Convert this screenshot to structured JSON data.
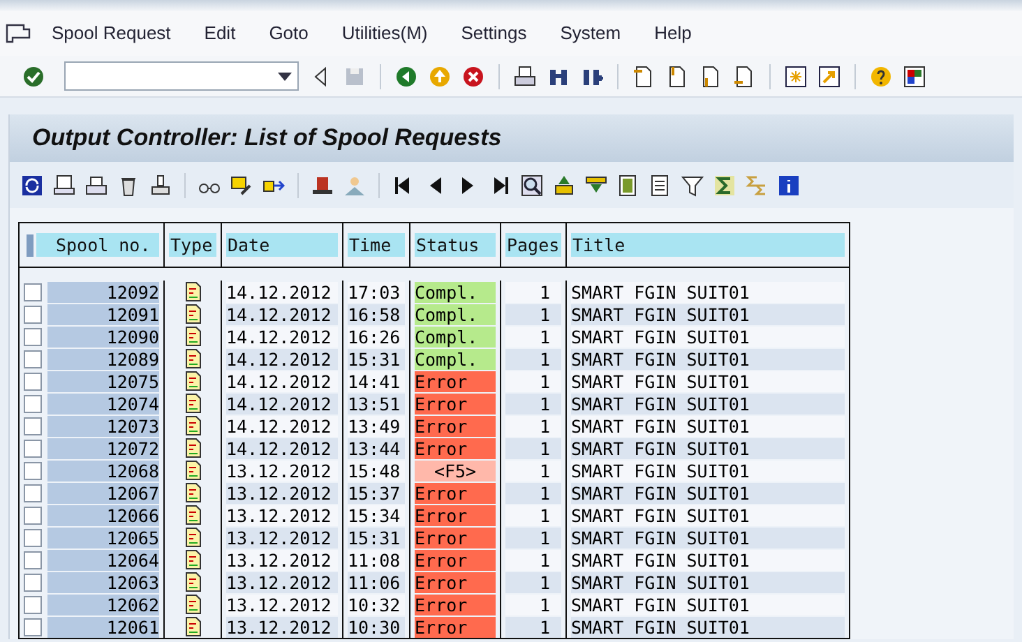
{
  "menu": [
    "Spool Request",
    "Edit",
    "Goto",
    "Utilities(M)",
    "Settings",
    "System",
    "Help"
  ],
  "title": "Output Controller: List of Spool Requests",
  "table": {
    "columns": [
      "Spool no.",
      "Type",
      "Date",
      "Time",
      "Status",
      "Pages",
      "Title"
    ],
    "rows": [
      {
        "spool": "12092",
        "checked": false,
        "date": "14.12.2012",
        "time": "17:03",
        "status": "Compl.",
        "kind": "complete",
        "pages": "1",
        "title": "SMART FGIN SUIT01"
      },
      {
        "spool": "12091",
        "checked": false,
        "date": "14.12.2012",
        "time": "16:58",
        "status": "Compl.",
        "kind": "complete",
        "pages": "1",
        "title": "SMART FGIN SUIT01"
      },
      {
        "spool": "12090",
        "checked": false,
        "date": "14.12.2012",
        "time": "16:26",
        "status": "Compl.",
        "kind": "complete",
        "pages": "1",
        "title": "SMART FGIN SUIT01"
      },
      {
        "spool": "12089",
        "checked": false,
        "date": "14.12.2012",
        "time": "15:31",
        "status": "Compl.",
        "kind": "complete",
        "pages": "1",
        "title": "SMART FGIN SUIT01"
      },
      {
        "spool": "12075",
        "checked": false,
        "date": "14.12.2012",
        "time": "14:41",
        "status": "Error",
        "kind": "error",
        "pages": "1",
        "title": "SMART FGIN SUIT01"
      },
      {
        "spool": "12074",
        "checked": false,
        "date": "14.12.2012",
        "time": "13:51",
        "status": "Error",
        "kind": "error",
        "pages": "1",
        "title": "SMART FGIN SUIT01"
      },
      {
        "spool": "12073",
        "checked": false,
        "date": "14.12.2012",
        "time": "13:49",
        "status": "Error",
        "kind": "error",
        "pages": "1",
        "title": "SMART FGIN SUIT01"
      },
      {
        "spool": "12072",
        "checked": false,
        "date": "14.12.2012",
        "time": "13:44",
        "status": "Error",
        "kind": "error",
        "pages": "1",
        "title": "SMART FGIN SUIT01"
      },
      {
        "spool": "12068",
        "checked": false,
        "date": "13.12.2012",
        "time": "15:48",
        "status": "<F5>",
        "kind": "waiting",
        "pages": "1",
        "title": "SMART FGIN SUIT01"
      },
      {
        "spool": "12067",
        "checked": false,
        "date": "13.12.2012",
        "time": "15:37",
        "status": "Error",
        "kind": "error",
        "pages": "1",
        "title": "SMART FGIN SUIT01"
      },
      {
        "spool": "12066",
        "checked": false,
        "date": "13.12.2012",
        "time": "15:34",
        "status": "Error",
        "kind": "error",
        "pages": "1",
        "title": "SMART FGIN SUIT01"
      },
      {
        "spool": "12065",
        "checked": false,
        "date": "13.12.2012",
        "time": "15:31",
        "status": "Error",
        "kind": "error",
        "pages": "1",
        "title": "SMART FGIN SUIT01"
      },
      {
        "spool": "12064",
        "checked": false,
        "date": "13.12.2012",
        "time": "11:08",
        "status": "Error",
        "kind": "error",
        "pages": "1",
        "title": "SMART FGIN SUIT01"
      },
      {
        "spool": "12063",
        "checked": false,
        "date": "13.12.2012",
        "time": "11:06",
        "status": "Error",
        "kind": "error",
        "pages": "1",
        "title": "SMART FGIN SUIT01"
      },
      {
        "spool": "12062",
        "checked": false,
        "date": "13.12.2012",
        "time": "10:32",
        "status": "Error",
        "kind": "error",
        "pages": "1",
        "title": "SMART FGIN SUIT01"
      },
      {
        "spool": "12061",
        "checked": false,
        "date": "13.12.2012",
        "time": "10:30",
        "status": "Error",
        "kind": "error",
        "pages": "1",
        "title": "SMART FGIN SUIT01"
      }
    ]
  }
}
